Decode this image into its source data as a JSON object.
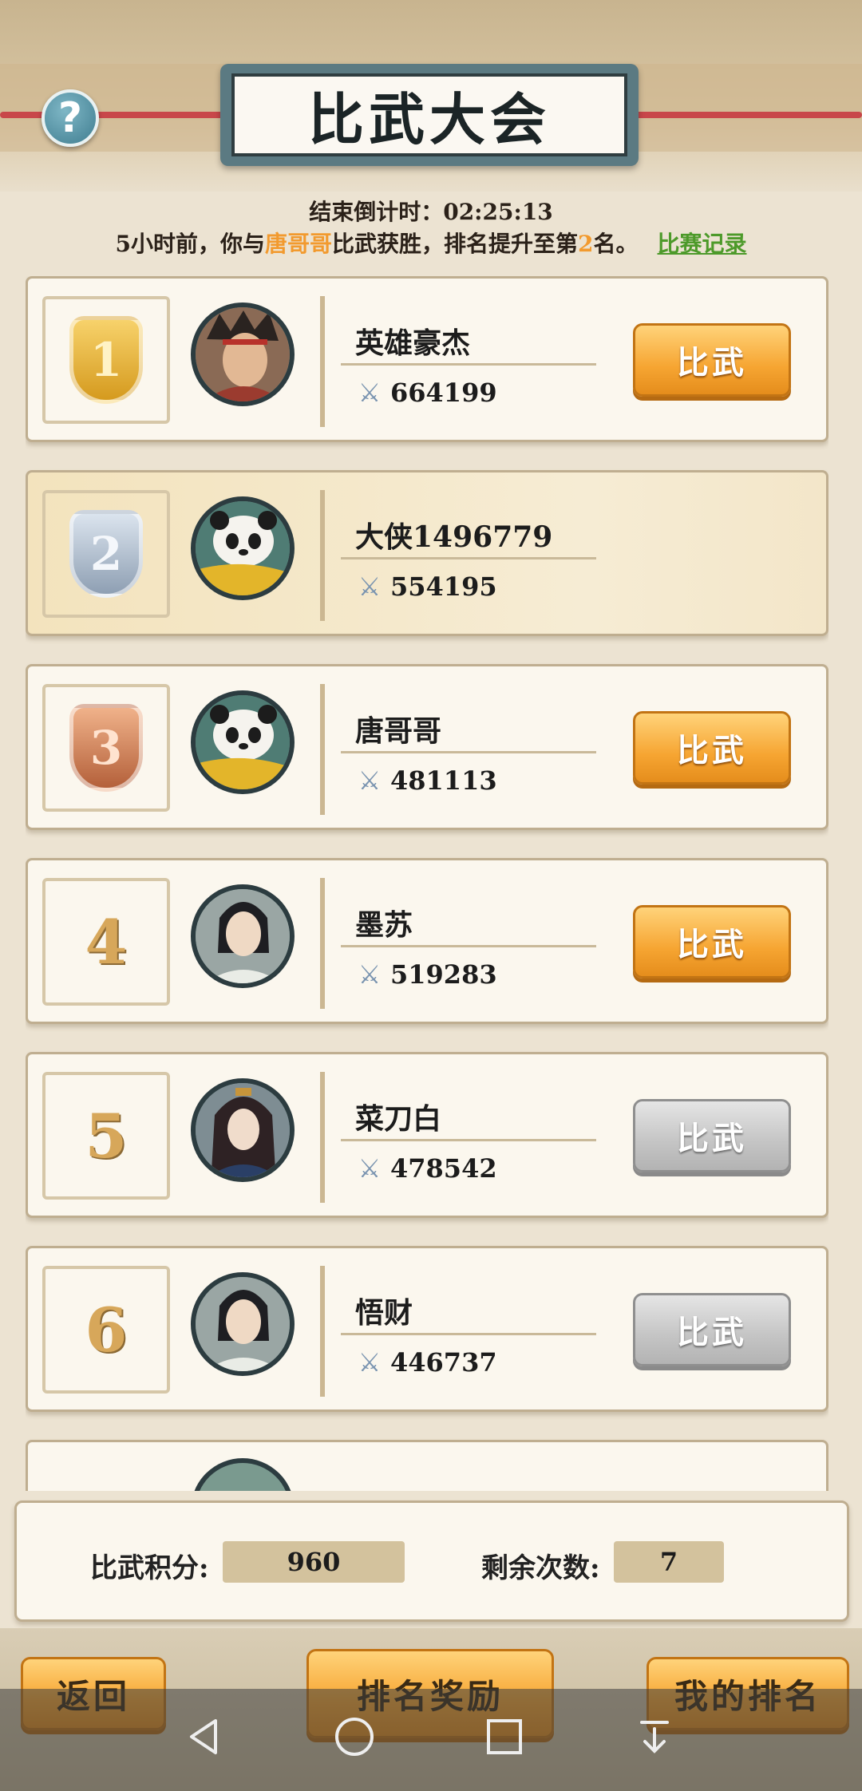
{
  "header": {
    "title": "比武大会",
    "help_label": "?"
  },
  "countdown": {
    "label": "结束倒计时：",
    "value": "02:25:13"
  },
  "notice": {
    "prefix": "5小时前，你与",
    "opponent": "唐哥哥",
    "middle": "比武获胜，排名提升至第",
    "rank": "2",
    "suffix": "名。",
    "record_link": "比赛记录"
  },
  "ranking": [
    {
      "rank": "1",
      "medal": "gold",
      "name": "英雄豪杰",
      "power": "664199",
      "button": "比武",
      "button_state": "active",
      "avatar": "warrior-avatar"
    },
    {
      "rank": "2",
      "medal": "silver",
      "name": "大侠1496779",
      "power": "554195",
      "button": "",
      "button_state": "self",
      "avatar": "panda-avatar"
    },
    {
      "rank": "3",
      "medal": "bronze",
      "name": "唐哥哥",
      "power": "481113",
      "button": "比武",
      "button_state": "active",
      "avatar": "panda-avatar"
    },
    {
      "rank": "4",
      "medal": "",
      "name": "墨苏",
      "power": "519283",
      "button": "比武",
      "button_state": "active",
      "avatar": "scholar-avatar"
    },
    {
      "rank": "5",
      "medal": "",
      "name": "菜刀白",
      "power": "478542",
      "button": "比武",
      "button_state": "disabled",
      "avatar": "lady-avatar"
    },
    {
      "rank": "6",
      "medal": "",
      "name": "悟财",
      "power": "446737",
      "button": "比武",
      "button_state": "disabled",
      "avatar": "scholar-avatar"
    }
  ],
  "stats": {
    "points_label": "比武积分:",
    "points_value": "960",
    "remaining_label": "剩余次数:",
    "remaining_value": "7"
  },
  "bottom_buttons": {
    "back": "返回",
    "rewards": "排名奖励",
    "my_rank": "我的排名"
  },
  "colors": {
    "accent_orange": "#f6a532",
    "highlight_name": "#f29a2e",
    "link_green": "#4d9a2a",
    "title_plate": "#5b7a82"
  }
}
